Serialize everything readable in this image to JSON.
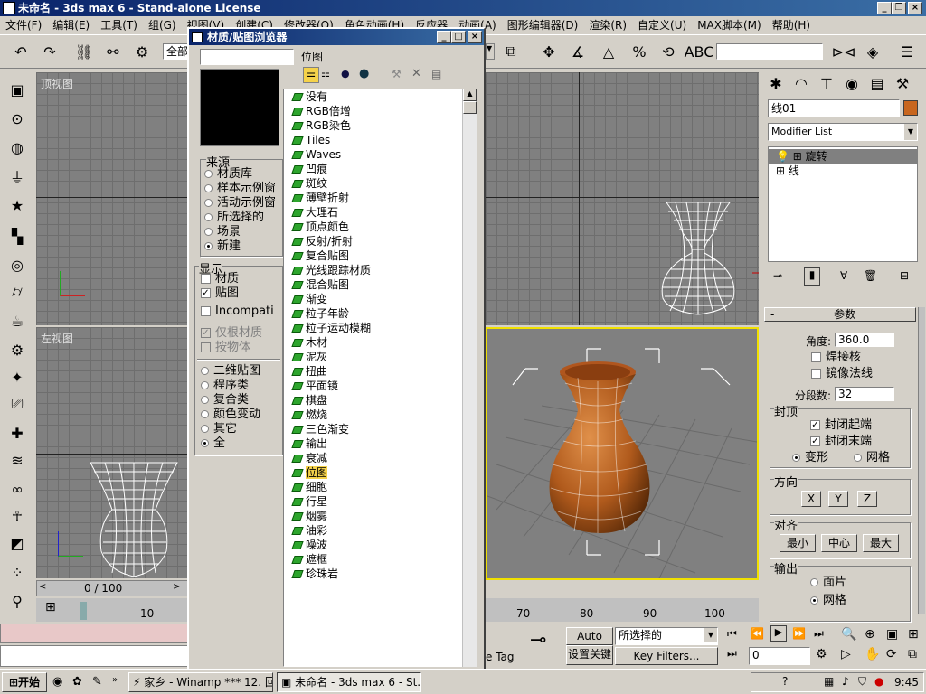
{
  "window": {
    "title": "未命名 - 3ds max 6 - Stand-alone License"
  },
  "menu": [
    "文件(F)",
    "编辑(E)",
    "工具(T)",
    "组(G)",
    "视图(V)",
    "创建(C)",
    "修改器(O)",
    "角色动画(H)",
    "反应器",
    "动画(A)",
    "图形编辑器(D)",
    "渲染(R)",
    "自定义(U)",
    "MAX脚本(M)",
    "帮助(H)"
  ],
  "toolbar": {
    "selection_set": "全部"
  },
  "viewports": {
    "top": "顶视图",
    "left": "左视图"
  },
  "timeline": {
    "frame": "0 / 100",
    "ticks": [
      "10",
      "70",
      "80",
      "90",
      "100"
    ]
  },
  "browser": {
    "title": "材质/贴图浏览器",
    "search_value": "",
    "current": "位图",
    "source_label": "来源",
    "source_options": [
      {
        "label": "材质库",
        "checked": false
      },
      {
        "label": "样本示例窗",
        "checked": false
      },
      {
        "label": "活动示例窗",
        "checked": false
      },
      {
        "label": "所选择的",
        "checked": false
      },
      {
        "label": "场景",
        "checked": false
      },
      {
        "label": "新建",
        "checked": true
      }
    ],
    "show_label": "显示",
    "show_options": [
      {
        "label": "材质",
        "checked": false
      },
      {
        "label": "贴图",
        "checked": true
      },
      {
        "label": "Incompati",
        "checked": false
      }
    ],
    "root_only": "仅根材质",
    "by_object": "按物体",
    "type_options": [
      {
        "label": "二维贴图",
        "checked": false
      },
      {
        "label": "程序类",
        "checked": false
      },
      {
        "label": "复合类",
        "checked": false
      },
      {
        "label": "颜色变动",
        "checked": false
      },
      {
        "label": "其它",
        "checked": false
      },
      {
        "label": "全",
        "checked": true
      }
    ],
    "items": [
      "没有",
      "RGB倍增",
      "RGB染色",
      "Tiles",
      "Waves",
      "凹痕",
      "斑纹",
      "薄壁折射",
      "大理石",
      "顶点颜色",
      "反射/折射",
      "复合贴图",
      "光线跟踪材质",
      "混合贴图",
      "渐变",
      "粒子年龄",
      "粒子运动模糊",
      "木材",
      "泥灰",
      "扭曲",
      "平面镜",
      "棋盘",
      "燃烧",
      "三色渐变",
      "输出",
      "衰减",
      "位图",
      "细胞",
      "行星",
      "烟雾",
      "油彩",
      "噪波",
      "遮框",
      "珍珠岩"
    ],
    "selected_item": "位图"
  },
  "command_panel": {
    "object_name": "线01",
    "object_color": "#c8661e",
    "modifier_list": "Modifier List",
    "stack": [
      "旋转",
      "线"
    ],
    "rollup_title": "参数",
    "degrees_label": "角度:",
    "degrees_value": "360.0",
    "weld_core": "焊接核",
    "flip_normals": "镜像法线",
    "segments_label": "分段数:",
    "segments_value": "32",
    "capping_label": "封顶",
    "cap_start": "封闭起端",
    "cap_end": "封闭末端",
    "morph": "变形",
    "grid": "网格",
    "direction_label": "方向",
    "dir_buttons": [
      "X",
      "Y",
      "Z"
    ],
    "align_label": "对齐",
    "align_buttons": [
      "最小",
      "中心",
      "最大"
    ],
    "output_label": "输出",
    "output_options": [
      "面片",
      "网格"
    ]
  },
  "anim": {
    "auto_key": "Auto Key",
    "selected": "所选择的",
    "set_key": "设置关键点",
    "key_filters": "Key Filters...",
    "frame": "0",
    "tag": "e Tag"
  },
  "taskbar": {
    "start": "开始",
    "tasks": [
      "家乡 - Winamp *** 12. 回",
      "未命名 - 3ds max 6 - St..."
    ],
    "clock": "9:45"
  },
  "colors": {
    "accent": "#0a246a",
    "selection_yellow": "#f5d24a",
    "viewport_bg": "#808080",
    "active_border": "#f0e000"
  }
}
